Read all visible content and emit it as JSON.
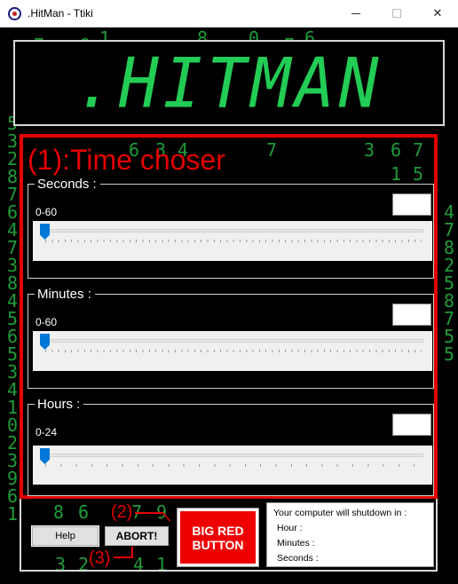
{
  "window": {
    "title": ".HitMan - Ttiki",
    "icon": "hitman-app-icon",
    "controls": [
      "minimize",
      "maximize",
      "close"
    ]
  },
  "logo": {
    "text": ".HITMAN"
  },
  "time_chooser": {
    "annotation": "(1):Time choser",
    "groups": [
      {
        "key": "seconds",
        "label": "Seconds :",
        "range": "0-60",
        "value": "",
        "slider_value": 0
      },
      {
        "key": "minutes",
        "label": "Minutes :",
        "range": "0-60",
        "value": "",
        "slider_value": 0
      },
      {
        "key": "hours",
        "label": "Hours :",
        "range": "0-24",
        "value": "",
        "slider_value": 0
      }
    ]
  },
  "buttons": {
    "help": "Help",
    "abort": "ABORT!",
    "big_red": "BIG RED BUTTON"
  },
  "annotations": {
    "two": "(2)",
    "three": "(3)"
  },
  "shutdown_info": {
    "heading": "Your computer will shutdown in :",
    "hour": "Hour :",
    "minutes": "Minutes :",
    "seconds": "Seconds :"
  },
  "matrix_digits": [
    "1",
    "8",
    "0",
    "6",
    "7",
    "9",
    "7",
    "5",
    "3",
    "2",
    "8",
    "7",
    "6",
    "4",
    "7",
    "3",
    "8",
    "4",
    "5",
    "6",
    "5",
    "3",
    "4",
    "1",
    "0",
    "2",
    "3",
    "9",
    "6",
    "1",
    "4",
    "7",
    "8",
    "2",
    "5",
    "8",
    "7",
    "5",
    "5",
    "6",
    "7",
    "1",
    "5",
    "8",
    "6",
    "7",
    "9",
    "3",
    "2",
    "4",
    "1",
    "6",
    "3",
    "4",
    "7",
    "3"
  ],
  "colors": {
    "matrix_green": "#1f9b3a",
    "logo_green": "#22cc55",
    "annotation_red": "#e30000",
    "big_red_button": "#ee0000",
    "slider_thumb": "#0078d7"
  }
}
